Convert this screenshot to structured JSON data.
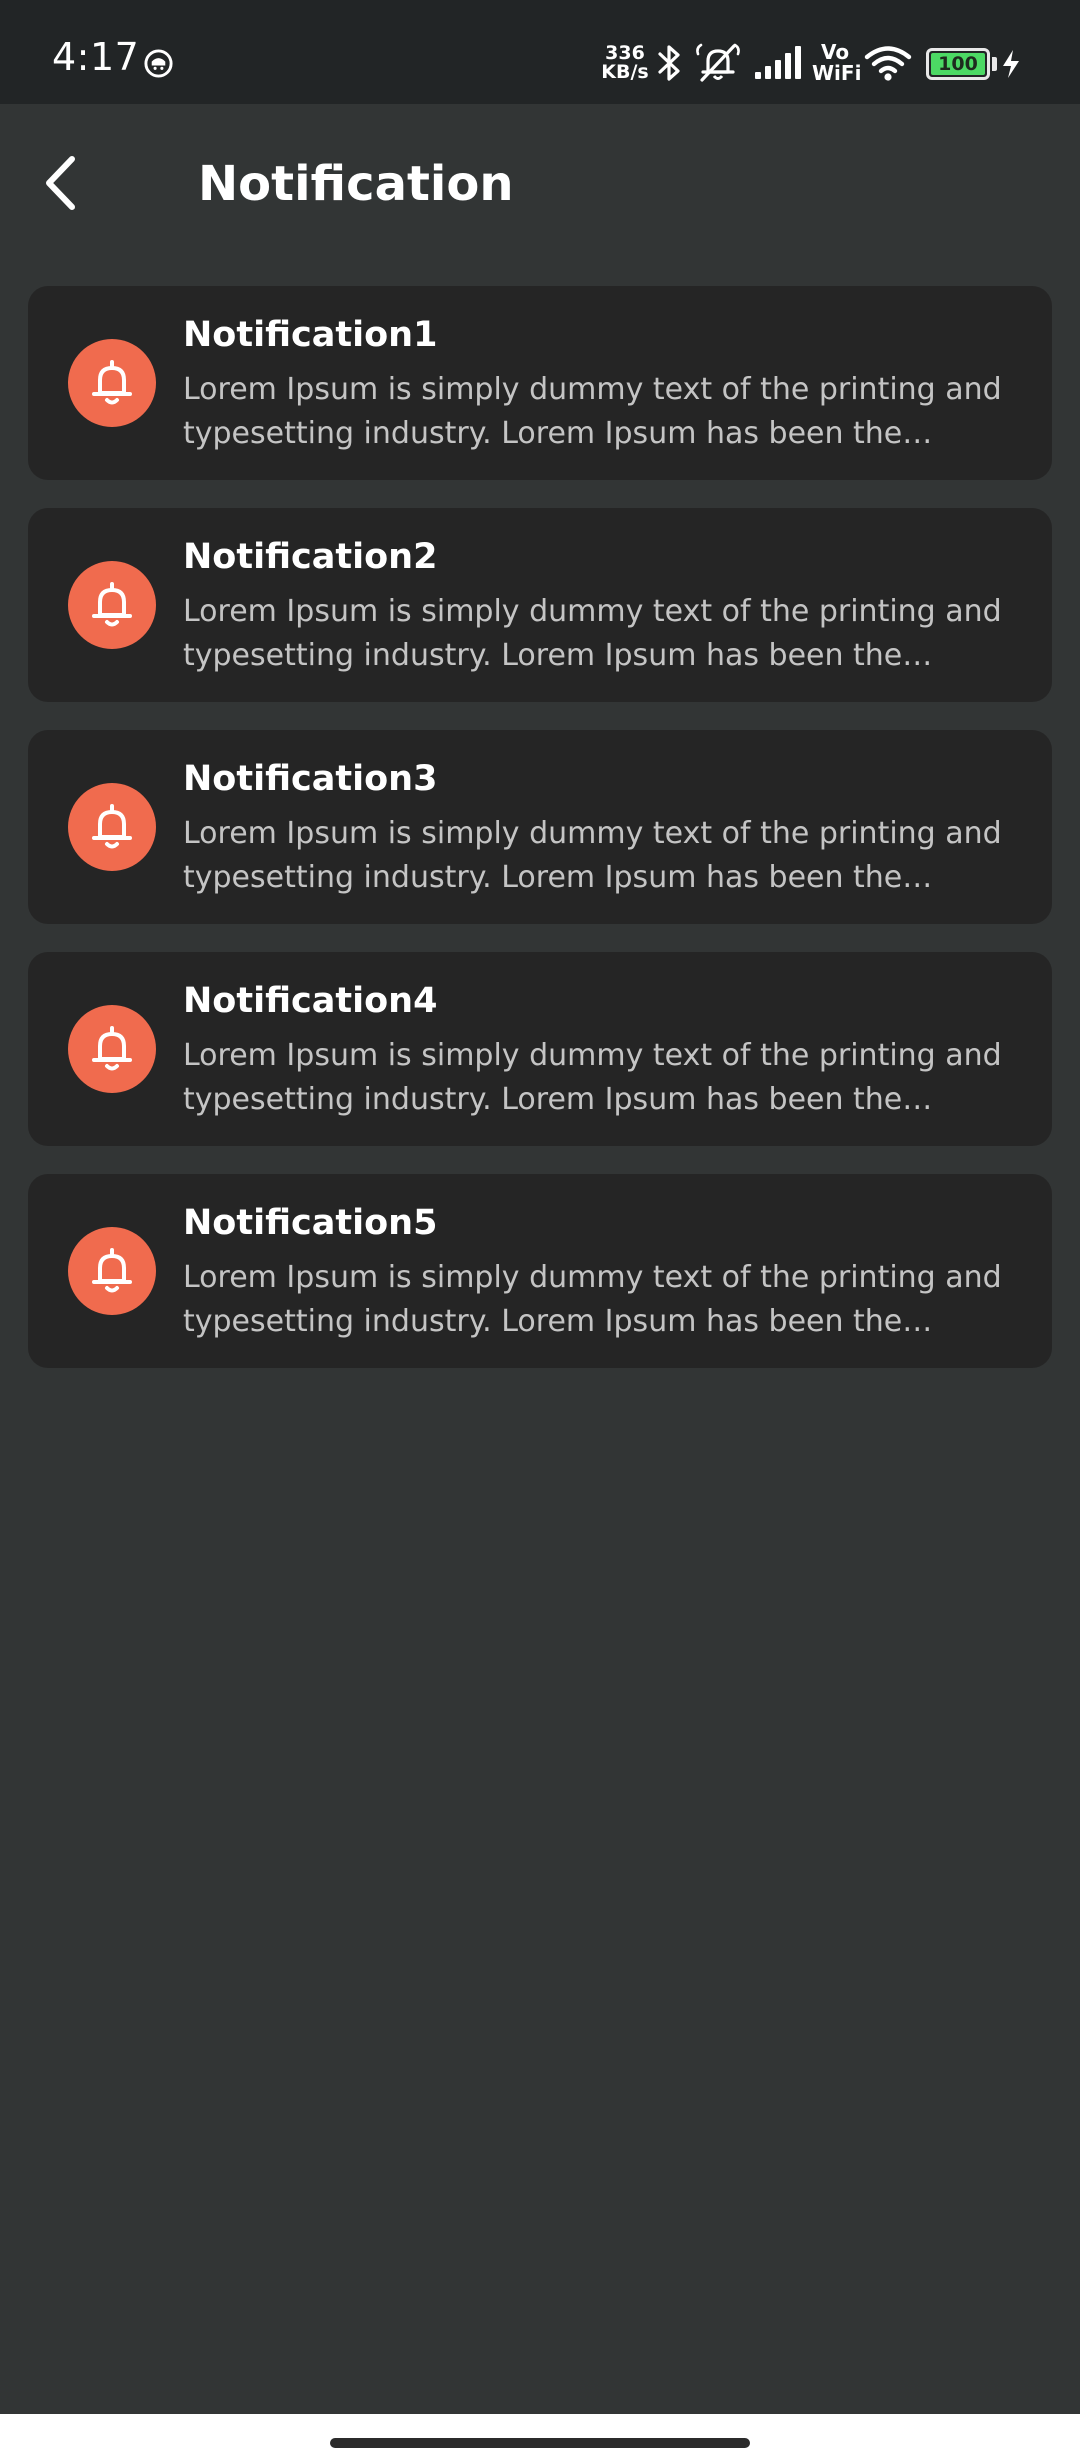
{
  "status_bar": {
    "time": "4:17",
    "network_speed_value": "336",
    "network_speed_unit": "KB/s",
    "vowifi_top": "Vo",
    "vowifi_bottom": "WiFi",
    "battery_level": "100",
    "battery_color": "#4cd964"
  },
  "header": {
    "back_icon": "chevron-left-icon",
    "title": "Notification"
  },
  "theme": {
    "background": "#323535",
    "card_background": "#252525",
    "accent": "#f06b4e",
    "body_text": "#c4c4c4"
  },
  "notifications": [
    {
      "title": "Notification1",
      "body": "Lorem Ipsum is simply dummy text of the printing and typesetting industry. Lorem Ipsum has been the industry's...",
      "icon": "bell-icon"
    },
    {
      "title": "Notification2",
      "body": "Lorem Ipsum is simply dummy text of the printing and typesetting industry. Lorem Ipsum has been the industry's...",
      "icon": "bell-icon"
    },
    {
      "title": "Notification3",
      "body": "Lorem Ipsum is simply dummy text of the printing and typesetting industry. Lorem Ipsum has been the industry's...",
      "icon": "bell-icon"
    },
    {
      "title": "Notification4",
      "body": "Lorem Ipsum is simply dummy text of the printing and typesetting industry. Lorem Ipsum has been the industry's...",
      "icon": "bell-icon"
    },
    {
      "title": "Notification5",
      "body": "Lorem Ipsum is simply dummy text of the printing and typesetting industry. Lorem Ipsum has been the industry's...",
      "icon": "bell-icon"
    }
  ]
}
